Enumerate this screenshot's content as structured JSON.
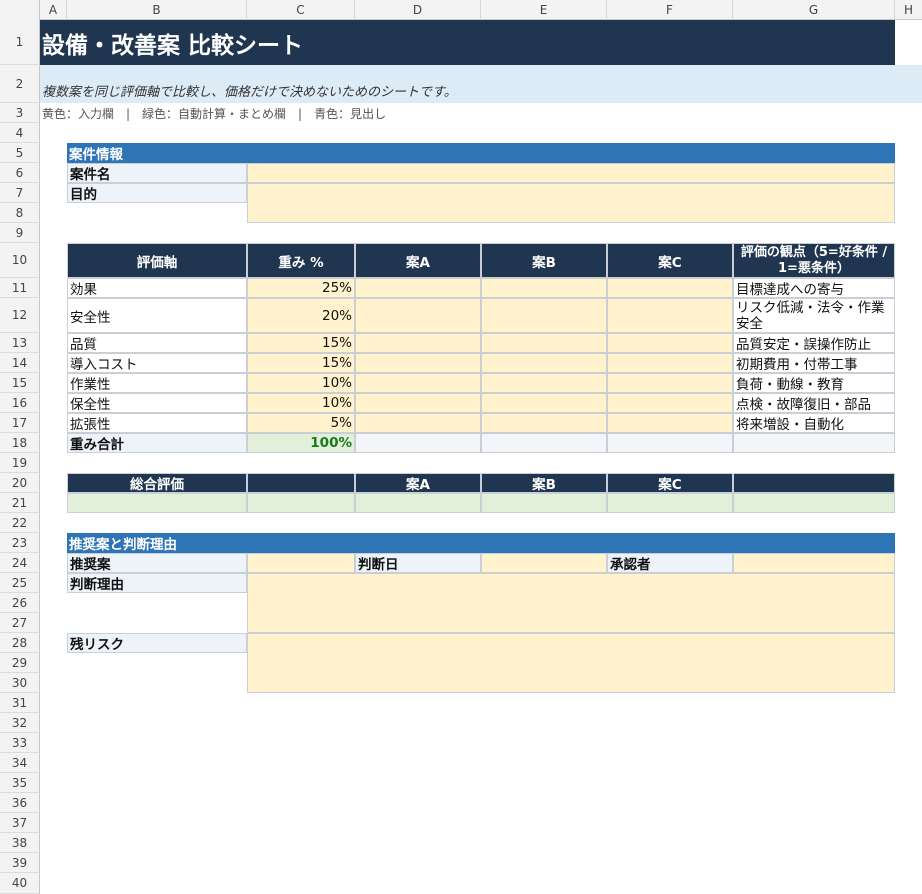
{
  "columns": [
    "A",
    "B",
    "C",
    "D",
    "E",
    "F",
    "G",
    "H"
  ],
  "rows": [
    "1",
    "2",
    "3",
    "4",
    "5",
    "6",
    "7",
    "8",
    "9",
    "10",
    "11",
    "12",
    "13",
    "14",
    "15",
    "16",
    "17",
    "18",
    "19",
    "20",
    "21",
    "22",
    "23",
    "24",
    "25",
    "26",
    "27",
    "28",
    "29",
    "30",
    "31",
    "32",
    "33",
    "34",
    "35",
    "36",
    "37",
    "38",
    "39",
    "40"
  ],
  "sheet": {
    "title": "設備・改善案 比較シート",
    "subtitle": "複数案を同じ評価軸で比較し、価格だけで決めないためのシートです。",
    "legend": "黄色：入力欄　|　緑色：自動計算・まとめ欄　|　青色：見出し"
  },
  "case_info": {
    "header": "案件情報",
    "name_label": "案件名",
    "purpose_label": "目的"
  },
  "criteria_table": {
    "headers": {
      "axis": "評価軸",
      "weight": "重み %",
      "plan_a": "案A",
      "plan_b": "案B",
      "plan_c": "案C",
      "viewpoint": "評価の観点（5=好条件 / 1=悪条件）"
    },
    "rows": [
      {
        "axis": "効果",
        "weight": "25%",
        "viewpoint": "目標達成への寄与"
      },
      {
        "axis": "安全性",
        "weight": "20%",
        "viewpoint": "リスク低減・法令・作業安全"
      },
      {
        "axis": "品質",
        "weight": "15%",
        "viewpoint": "品質安定・誤操作防止"
      },
      {
        "axis": "導入コスト",
        "weight": "15%",
        "viewpoint": "初期費用・付帯工事"
      },
      {
        "axis": "作業性",
        "weight": "10%",
        "viewpoint": "負荷・動線・教育"
      },
      {
        "axis": "保全性",
        "weight": "10%",
        "viewpoint": "点検・故障復旧・部品"
      },
      {
        "axis": "拡張性",
        "weight": "5%",
        "viewpoint": "将来増設・自動化"
      }
    ],
    "total_label": "重み合計",
    "total_value": "100%"
  },
  "overall": {
    "header": "総合評価",
    "plan_a": "案A",
    "plan_b": "案B",
    "plan_c": "案C"
  },
  "recommendation": {
    "header": "推奨案と判断理由",
    "recommended_label": "推奨案",
    "date_label": "判断日",
    "approver_label": "承認者",
    "reason_label": "判断理由",
    "risk_label": "残リスク"
  },
  "colors": {
    "input": "#fff2cc",
    "calc": "#e2efda",
    "heading_dark": "#1f3550",
    "heading_blue": "#2e75b6",
    "total_text": "#1a7a1a"
  }
}
